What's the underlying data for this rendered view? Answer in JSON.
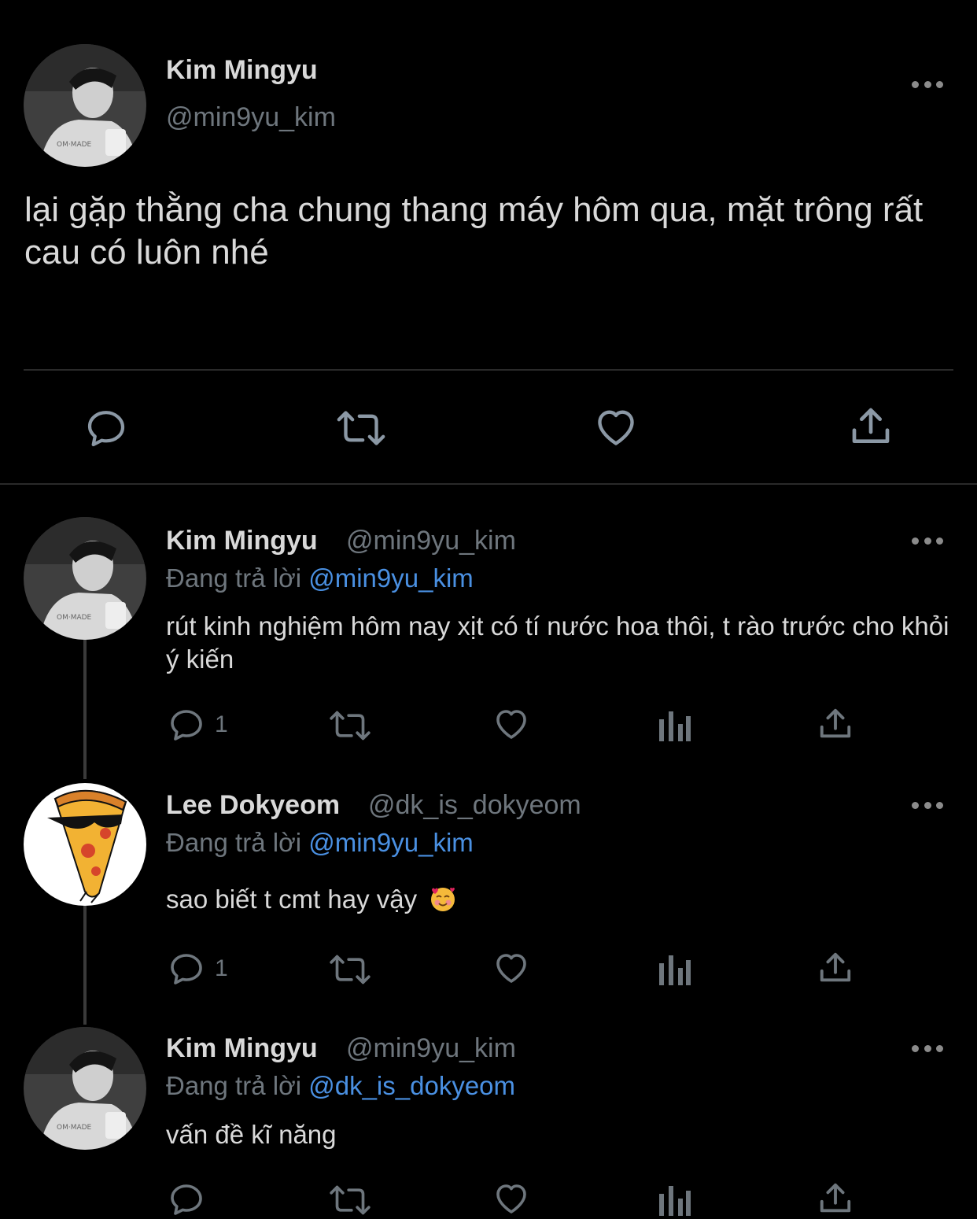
{
  "main_tweet": {
    "author_name": "Kim Mingyu",
    "author_handle": "@min9yu_kim",
    "text": "lại gặp thằng cha chung thang máy hôm qua, mặt trông rất cau có luôn nhé"
  },
  "replies": [
    {
      "author_name": "Kim Mingyu",
      "author_handle": "@min9yu_kim",
      "replying_label": "Đang trả lời",
      "replying_to": "@min9yu_kim",
      "text": "rút kinh nghiệm hôm nay xịt có tí nước hoa thôi, t rào trước cho khỏi ý kiến",
      "reply_count": "1"
    },
    {
      "author_name": "Lee Dokyeom",
      "author_handle": "@dk_is_dokyeom",
      "replying_label": "Đang trả lời",
      "replying_to": "@min9yu_kim",
      "text": "sao biết t cmt hay vậy",
      "emoji": "smiling-face-with-hearts",
      "reply_count": "1"
    },
    {
      "author_name": "Kim Mingyu",
      "author_handle": "@min9yu_kim",
      "replying_label": "Đang trả lời",
      "replying_to": "@dk_is_dokyeom",
      "text": "vấn đề kĩ năng"
    }
  ],
  "colors": {
    "background": "#000000",
    "text": "#d9d9d9",
    "secondary": "#6e767d",
    "mention": "#4a90e2"
  },
  "icons": [
    "reply-icon",
    "retweet-icon",
    "like-icon",
    "share-icon",
    "analytics-icon",
    "more-icon"
  ]
}
